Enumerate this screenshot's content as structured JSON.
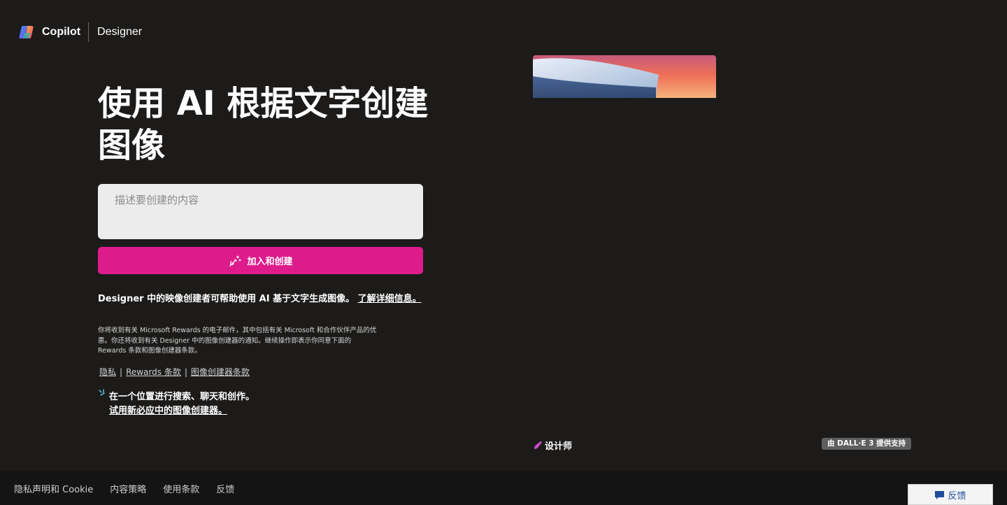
{
  "header": {
    "brand": "Copilot",
    "product": "Designer",
    "icons": [
      "copilot-logo-icon"
    ]
  },
  "hero": {
    "title": "使用 AI 根据文字创建图像"
  },
  "prompt": {
    "placeholder": "描述要创建的内容",
    "value": ""
  },
  "create_button": {
    "label": "加入和创建",
    "icon": "wand-sparkle-icon",
    "color": "#dd1b8b"
  },
  "description": {
    "text": "Designer 中的映像创建者可帮助使用 AI 基于文字生成图像。",
    "link": "了解详细信息。"
  },
  "small_print": "你将收到有关 Microsoft Rewards 的电子邮件，其中包括有关 Microsoft 和合作伙伴产品的优惠。你还将收到有关 Designer 中的图像创建器的通知。继续操作即表示你同意下面的 Rewards 条款和图像创建器条款。",
  "legal_links": {
    "privacy": "隐私",
    "separator": "|",
    "rewards_terms": "Rewards 条款",
    "creator_terms": "图像创建器条款"
  },
  "promo": {
    "line1": "在一个位置进行搜索、聊天和创作。",
    "line2": "试用新必应中的图像创建器。",
    "icon": "sparkle-icon"
  },
  "showcase": {
    "designer_tag": "设计师",
    "powered_by": "由 DALL·E 3 提供支持"
  },
  "footer": {
    "links": [
      "隐私声明和 Cookie",
      "内容策略",
      "使用条款",
      "反馈"
    ],
    "feedback_button": "反馈"
  },
  "colors": {
    "background": "#1c1b1a",
    "accent": "#dd1b8b",
    "footer": "#141414"
  }
}
